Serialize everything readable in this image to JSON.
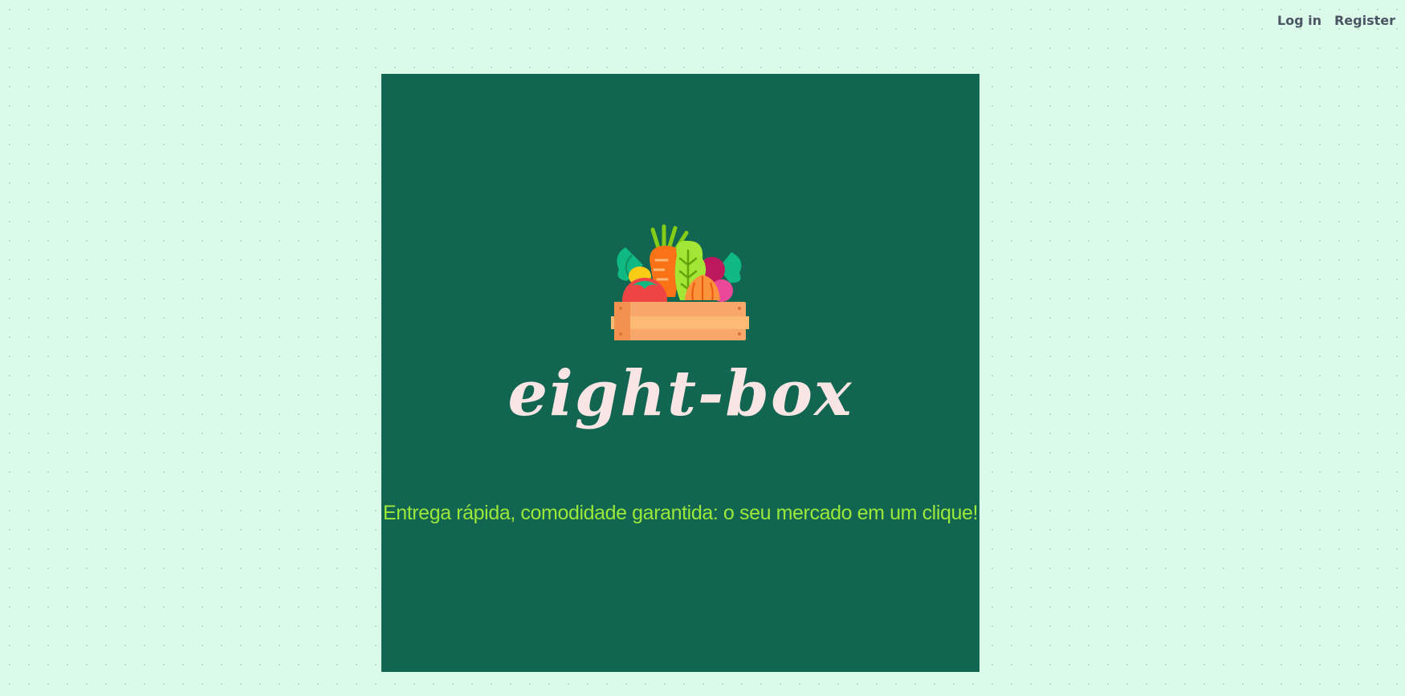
{
  "nav": {
    "login_label": "Log in",
    "register_label": "Register"
  },
  "hero": {
    "brand": "eight-box",
    "tagline": "Entrega rápida, comodidade garantida: o seu mercado em um clique!",
    "icon": "vegetable-crate-icon"
  },
  "colors": {
    "page_background": "#dcfae9",
    "hero_background": "#126651",
    "brand_text": "#fae5e5",
    "tagline_text": "#9be83a",
    "nav_text": "#4b5563"
  }
}
